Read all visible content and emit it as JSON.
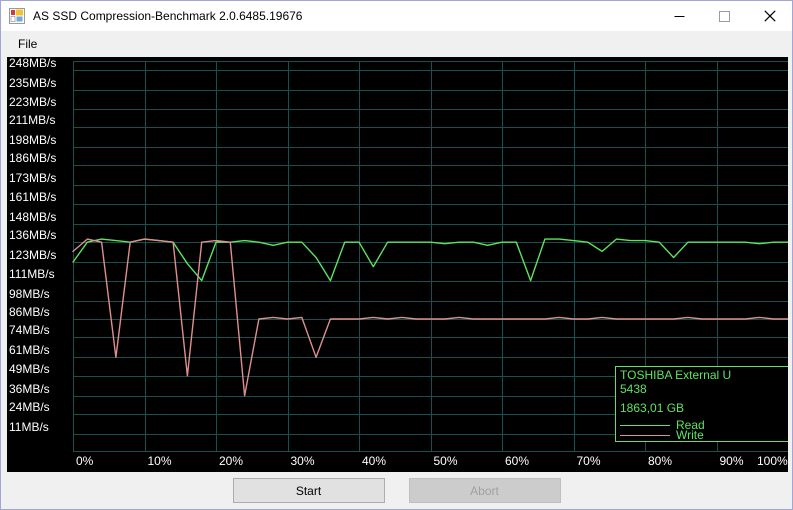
{
  "window": {
    "title": "AS SSD Compression-Benchmark 2.0.6485.19676",
    "icon": "app-window-icon",
    "minimize_label": "—",
    "maximize_label": "□",
    "close_label": "✕"
  },
  "menu": {
    "items": [
      {
        "label": "File"
      }
    ]
  },
  "buttons": {
    "start_label": "Start",
    "abort_label": "Abort"
  },
  "legend": {
    "device_line1": "TOSHIBA External U",
    "device_line2": "5438",
    "capacity": "1863,01 GB",
    "read_label": "Read",
    "write_label": "Write",
    "read_color": "#5fe35f",
    "write_color": "#e08f8f",
    "border_color": "#5fe35f",
    "text_color": "#5fe35f"
  },
  "chart_data": {
    "type": "line",
    "title": "",
    "xlabel": "",
    "ylabel": "",
    "background": "#000000",
    "grid": true,
    "grid_color": "#17504f",
    "axis_text_color": "#ffffff",
    "legend_position": "bottom-right",
    "xlim": [
      0,
      100
    ],
    "ylim": [
      0,
      254
    ],
    "xticks": [
      "0%",
      "10%",
      "20%",
      "30%",
      "40%",
      "50%",
      "60%",
      "70%",
      "80%",
      "90%",
      "100%"
    ],
    "xtick_values": [
      0,
      10,
      20,
      30,
      40,
      50,
      60,
      70,
      80,
      90,
      100
    ],
    "yticks": [
      "11MB/s",
      "24MB/s",
      "36MB/s",
      "49MB/s",
      "61MB/s",
      "74MB/s",
      "86MB/s",
      "98MB/s",
      "111MB/s",
      "123MB/s",
      "136MB/s",
      "148MB/s",
      "161MB/s",
      "173MB/s",
      "186MB/s",
      "198MB/s",
      "211MB/s",
      "223MB/s",
      "235MB/s",
      "248MB/s"
    ],
    "ytick_values": [
      11,
      24,
      36,
      49,
      61,
      74,
      86,
      98,
      111,
      123,
      136,
      148,
      161,
      173,
      186,
      198,
      211,
      223,
      235,
      248
    ],
    "x": [
      0,
      2,
      4,
      6,
      8,
      10,
      12,
      14,
      16,
      18,
      20,
      22,
      24,
      26,
      28,
      30,
      32,
      34,
      36,
      38,
      40,
      42,
      44,
      46,
      48,
      50,
      52,
      54,
      56,
      58,
      60,
      62,
      64,
      66,
      68,
      70,
      72,
      74,
      76,
      78,
      80,
      82,
      84,
      86,
      88,
      90,
      92,
      94,
      96,
      98,
      100
    ],
    "series": [
      {
        "name": "Read",
        "color": "#5fe35f",
        "values": [
          123,
          136,
          138,
          137,
          136,
          138,
          137,
          136,
          122,
          111,
          136,
          136,
          137,
          136,
          134,
          136,
          136,
          126,
          111,
          136,
          136,
          120,
          136,
          136,
          136,
          136,
          135,
          136,
          136,
          134,
          136,
          136,
          111,
          138,
          138,
          137,
          136,
          130,
          138,
          137,
          137,
          136,
          126,
          136,
          136,
          136,
          136,
          136,
          135,
          136,
          136
        ]
      },
      {
        "name": "Write",
        "color": "#e08f8f",
        "values": [
          130,
          138,
          136,
          61,
          136,
          138,
          137,
          136,
          49,
          136,
          137,
          136,
          36,
          86,
          87,
          86,
          87,
          61,
          86,
          86,
          86,
          87,
          86,
          87,
          86,
          86,
          86,
          87,
          86,
          86,
          86,
          86,
          86,
          86,
          87,
          86,
          86,
          87,
          86,
          86,
          86,
          86,
          86,
          87,
          86,
          86,
          86,
          86,
          87,
          86,
          86
        ]
      }
    ],
    "notes": "Compression benchmark sweep: read line holds ~136MB/s with periodic dips toward 111MB/s; write line starts near 136MB/s then settles around 86MB/s with deep spikes down to 36-61MB/s."
  }
}
